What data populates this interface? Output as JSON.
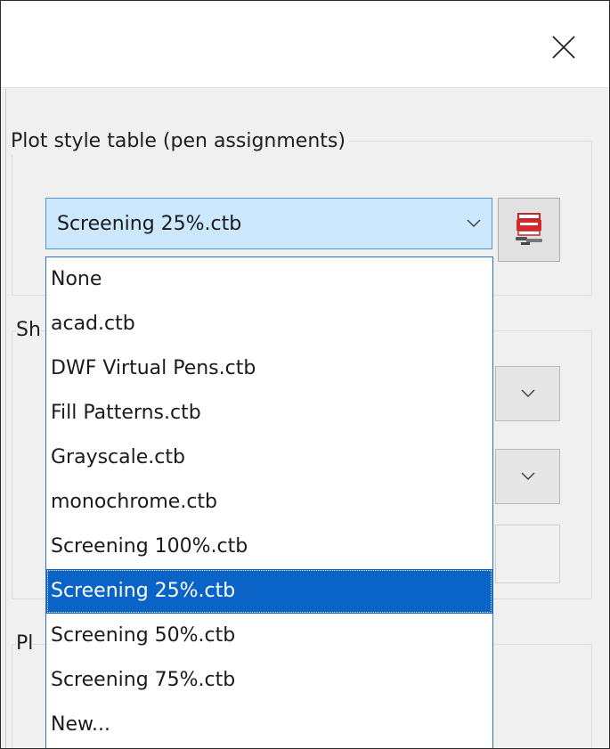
{
  "close_icon": "close-icon",
  "plot_style_group": {
    "legend": "Plot style table (pen assignments)",
    "selected_value": "Screening 25%.ctb",
    "chevron_icon": "chevron-down-icon",
    "edit_button_icon": "plotter-edit-icon"
  },
  "partial_labels": {
    "shaded": "Sh",
    "plot": "Pl"
  },
  "dropdown": {
    "options": [
      "None",
      "acad.ctb",
      "DWF Virtual Pens.ctb",
      "Fill Patterns.ctb",
      "Grayscale.ctb",
      "monochrome.ctb",
      "Screening 100%.ctb",
      "Screening 25%.ctb",
      "Screening 50%.ctb",
      "Screening 75%.ctb",
      "New..."
    ],
    "selected_index": 7
  },
  "colors": {
    "selection": "#0a64c8",
    "combo_focus_bg": "#cce8ff",
    "combo_border": "#4f95d8",
    "dialog_bg": "#f0f0f0"
  }
}
